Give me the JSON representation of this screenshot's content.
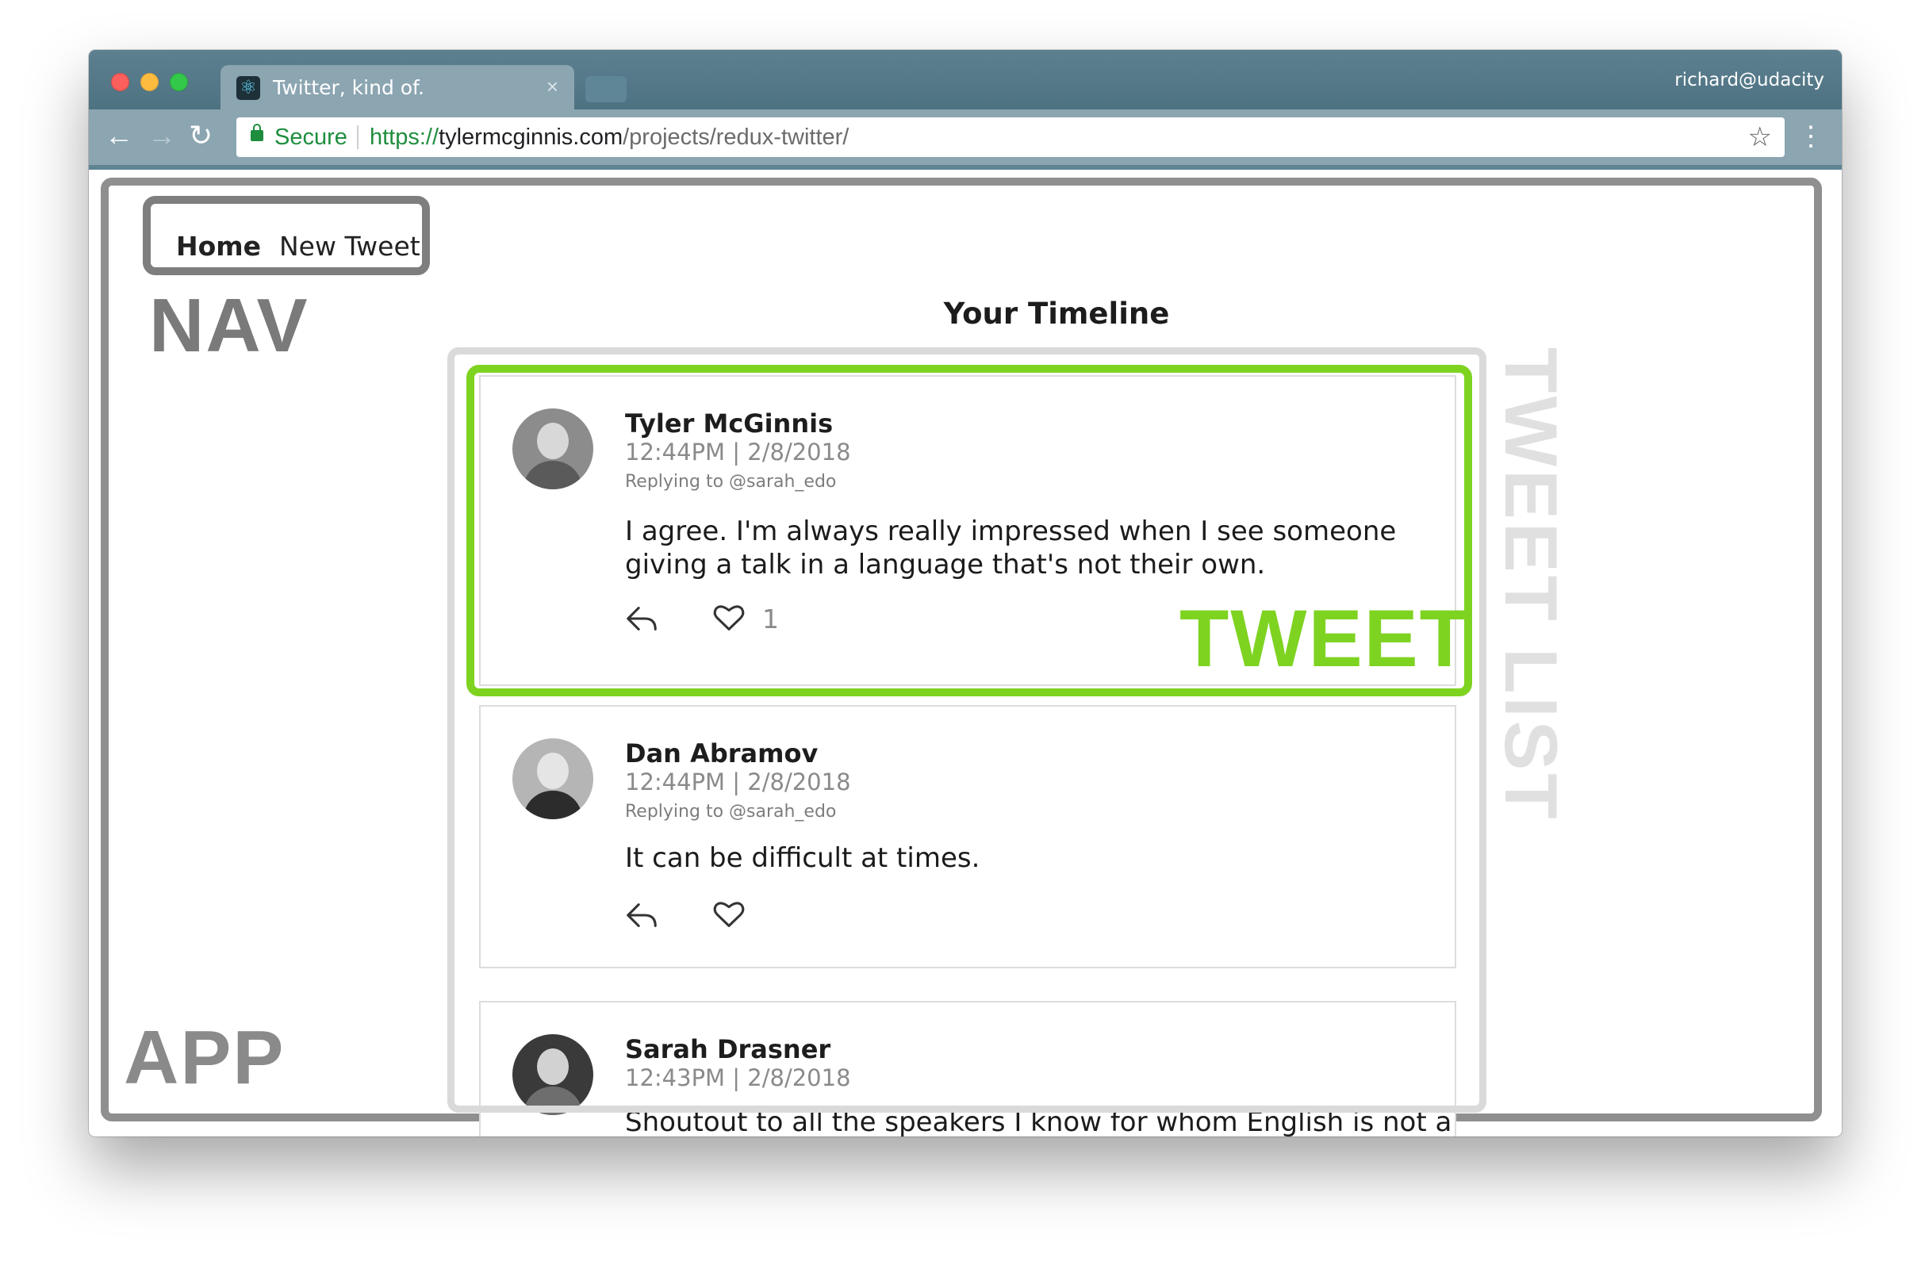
{
  "browser": {
    "tab_title": "Twitter, kind of.",
    "tab_close": "×",
    "user": "richard@udacity",
    "secure_label": "Secure",
    "url_scheme": "https://",
    "url_host": "tylermcginnis.com",
    "url_path": "/projects/redux-twitter/",
    "back_glyph": "←",
    "forward_glyph": "→",
    "reload_glyph": "↻",
    "star_glyph": "☆",
    "menu_glyph": "⋮",
    "favicon_glyph": "⚛"
  },
  "nav": {
    "links": [
      "Home",
      "New Tweet"
    ],
    "active": "Home"
  },
  "annotations": {
    "nav": "NAV",
    "app": "APP",
    "tweet_list": "TWEET LIST",
    "tweet": "TWEET"
  },
  "timeline": {
    "title": "Your Timeline",
    "tweets": [
      {
        "author": "Tyler McGinnis",
        "timestamp": "12:44PM | 2/8/2018",
        "replying_to": "Replying to @sarah_edo",
        "text": "I agree. I'm always really impressed when I see someone giving a talk in a language that's not their own.",
        "likes": "1",
        "icons": [
          "reply-icon",
          "heart-icon"
        ]
      },
      {
        "author": "Dan Abramov",
        "timestamp": "12:44PM | 2/8/2018",
        "replying_to": "Replying to @sarah_edo",
        "text": "It can be difficult at times.",
        "icons": [
          "reply-icon",
          "heart-icon"
        ]
      },
      {
        "author": "Sarah Drasner",
        "timestamp": "12:43PM | 2/8/2018",
        "text": "Shoutout to all the speakers I know for whom English is not a"
      }
    ]
  },
  "colors": {
    "tweet_highlight": "#7ed321",
    "titlebar": "#4f7585",
    "secure_green": "#1e8e3e"
  }
}
